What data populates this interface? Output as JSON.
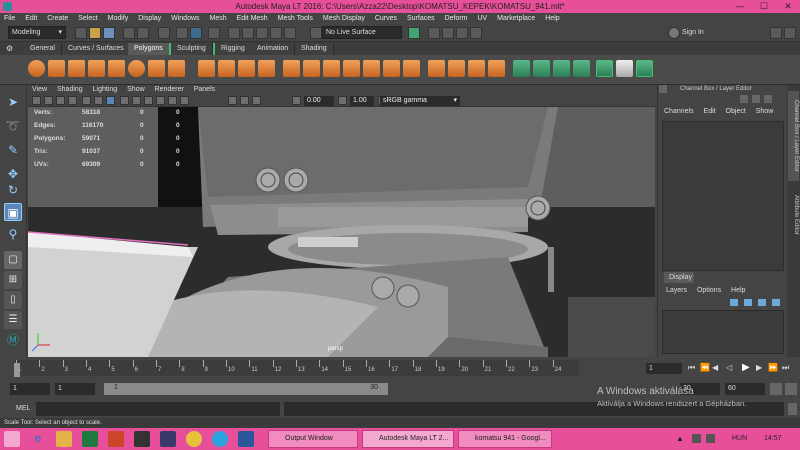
{
  "window": {
    "title": "Autodesk Maya LT 2016: C:\\Users\\Azza22\\Desktop\\KOMATSU_KEPEK\\KOMATSU_941.mlt*",
    "minimize": "—",
    "maximize": "☐",
    "close": "✕"
  },
  "menubar": [
    "File",
    "Edit",
    "Create",
    "Select",
    "Modify",
    "Display",
    "Windows",
    "Mesh",
    "Edit Mesh",
    "Mesh Tools",
    "Mesh Display",
    "Curves",
    "Surfaces",
    "Deform",
    "UV",
    "Marketplace",
    "Help"
  ],
  "statusline": {
    "mode": "Modeling",
    "live_surface": "No Live Surface",
    "sign_in": "Sign In"
  },
  "shelf_tabs": [
    "General",
    "Curves / Surfaces",
    "Polygons",
    "Sculpting",
    "Rigging",
    "Animation",
    "Shading"
  ],
  "active_shelf_tab": "Polygons",
  "panel_menu": [
    "View",
    "Shading",
    "Lighting",
    "Show",
    "Renderer",
    "Panels"
  ],
  "panel_toolbar": {
    "exposure": "0.00",
    "gamma": "1.00",
    "color_space": "sRGB gamma"
  },
  "hud": [
    {
      "label": "Verts:",
      "v1": "58318",
      "v2": "0",
      "v3": "0"
    },
    {
      "label": "Edges:",
      "v1": "116170",
      "v2": "0",
      "v3": "0"
    },
    {
      "label": "Polygons:",
      "v1": "59071",
      "v2": "0",
      "v3": "0"
    },
    {
      "label": "Tris:",
      "v1": "91037",
      "v2": "0",
      "v3": "0"
    },
    {
      "label": "UVs:",
      "v1": "69309",
      "v2": "0",
      "v3": "0"
    }
  ],
  "viewport": {
    "camera": "persp"
  },
  "channel_box": {
    "title": "Channel Box / Layer Editor",
    "menu": [
      "Channels",
      "Edit",
      "Object",
      "Show"
    ],
    "display_tab": "Display",
    "layer_menu": [
      "Layers",
      "Options",
      "Help"
    ]
  },
  "side_tabs": [
    "Channel Box / Layer Editor",
    "Attribute Editor"
  ],
  "time_slider": {
    "ticks": [
      "1",
      "2",
      "3",
      "4",
      "5",
      "6",
      "7",
      "8",
      "9",
      "10",
      "11",
      "12",
      "13",
      "14",
      "15",
      "16",
      "17",
      "18",
      "19",
      "20",
      "21",
      "22",
      "23",
      "24"
    ],
    "current_frame": "1"
  },
  "range_slider": {
    "start": "1",
    "anim_start": "1",
    "range_start": "1",
    "range_end": "30",
    "anim_end": "30",
    "end": "60"
  },
  "cmdline": {
    "label": "MEL"
  },
  "help_line": "Scale Tool: Select an object to scale.",
  "windows_watermark": {
    "line1": "A Windows aktiválása",
    "line2": "Aktiválja a Windows rendszert a Gépházban."
  },
  "taskbar": {
    "apps": [
      "Output Window",
      "Autodesk Maya LT 2...",
      "komatsu 941 - Googl..."
    ],
    "language": "HUN",
    "time": "14:57"
  },
  "colors": {
    "accent_pink": "#e84f9a",
    "orange_tool": "#e08a3c",
    "green_tool": "#3fa372",
    "ui_gray": "#444444"
  }
}
